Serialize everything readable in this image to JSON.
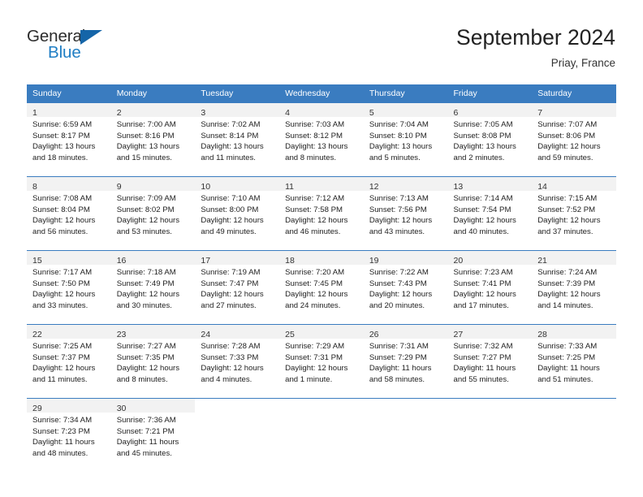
{
  "brand": {
    "word_one": "General",
    "word_two": "Blue",
    "triangle_color": "#1565a8",
    "blue_color": "#1f7ec4"
  },
  "header": {
    "title": "September 2024",
    "subtitle": "Priay, France"
  },
  "theme": {
    "header_blue": "#3a7cc0",
    "day_strip_gray": "#f2f2f2"
  },
  "weekdays": [
    "Sunday",
    "Monday",
    "Tuesday",
    "Wednesday",
    "Thursday",
    "Friday",
    "Saturday"
  ],
  "weeks": [
    [
      {
        "day": "1",
        "sunrise": "Sunrise: 6:59 AM",
        "sunset": "Sunset: 8:17 PM",
        "daylight_1": "Daylight: 13 hours",
        "daylight_2": "and 18 minutes."
      },
      {
        "day": "2",
        "sunrise": "Sunrise: 7:00 AM",
        "sunset": "Sunset: 8:16 PM",
        "daylight_1": "Daylight: 13 hours",
        "daylight_2": "and 15 minutes."
      },
      {
        "day": "3",
        "sunrise": "Sunrise: 7:02 AM",
        "sunset": "Sunset: 8:14 PM",
        "daylight_1": "Daylight: 13 hours",
        "daylight_2": "and 11 minutes."
      },
      {
        "day": "4",
        "sunrise": "Sunrise: 7:03 AM",
        "sunset": "Sunset: 8:12 PM",
        "daylight_1": "Daylight: 13 hours",
        "daylight_2": "and 8 minutes."
      },
      {
        "day": "5",
        "sunrise": "Sunrise: 7:04 AM",
        "sunset": "Sunset: 8:10 PM",
        "daylight_1": "Daylight: 13 hours",
        "daylight_2": "and 5 minutes."
      },
      {
        "day": "6",
        "sunrise": "Sunrise: 7:05 AM",
        "sunset": "Sunset: 8:08 PM",
        "daylight_1": "Daylight: 13 hours",
        "daylight_2": "and 2 minutes."
      },
      {
        "day": "7",
        "sunrise": "Sunrise: 7:07 AM",
        "sunset": "Sunset: 8:06 PM",
        "daylight_1": "Daylight: 12 hours",
        "daylight_2": "and 59 minutes."
      }
    ],
    [
      {
        "day": "8",
        "sunrise": "Sunrise: 7:08 AM",
        "sunset": "Sunset: 8:04 PM",
        "daylight_1": "Daylight: 12 hours",
        "daylight_2": "and 56 minutes."
      },
      {
        "day": "9",
        "sunrise": "Sunrise: 7:09 AM",
        "sunset": "Sunset: 8:02 PM",
        "daylight_1": "Daylight: 12 hours",
        "daylight_2": "and 53 minutes."
      },
      {
        "day": "10",
        "sunrise": "Sunrise: 7:10 AM",
        "sunset": "Sunset: 8:00 PM",
        "daylight_1": "Daylight: 12 hours",
        "daylight_2": "and 49 minutes."
      },
      {
        "day": "11",
        "sunrise": "Sunrise: 7:12 AM",
        "sunset": "Sunset: 7:58 PM",
        "daylight_1": "Daylight: 12 hours",
        "daylight_2": "and 46 minutes."
      },
      {
        "day": "12",
        "sunrise": "Sunrise: 7:13 AM",
        "sunset": "Sunset: 7:56 PM",
        "daylight_1": "Daylight: 12 hours",
        "daylight_2": "and 43 minutes."
      },
      {
        "day": "13",
        "sunrise": "Sunrise: 7:14 AM",
        "sunset": "Sunset: 7:54 PM",
        "daylight_1": "Daylight: 12 hours",
        "daylight_2": "and 40 minutes."
      },
      {
        "day": "14",
        "sunrise": "Sunrise: 7:15 AM",
        "sunset": "Sunset: 7:52 PM",
        "daylight_1": "Daylight: 12 hours",
        "daylight_2": "and 37 minutes."
      }
    ],
    [
      {
        "day": "15",
        "sunrise": "Sunrise: 7:17 AM",
        "sunset": "Sunset: 7:50 PM",
        "daylight_1": "Daylight: 12 hours",
        "daylight_2": "and 33 minutes."
      },
      {
        "day": "16",
        "sunrise": "Sunrise: 7:18 AM",
        "sunset": "Sunset: 7:49 PM",
        "daylight_1": "Daylight: 12 hours",
        "daylight_2": "and 30 minutes."
      },
      {
        "day": "17",
        "sunrise": "Sunrise: 7:19 AM",
        "sunset": "Sunset: 7:47 PM",
        "daylight_1": "Daylight: 12 hours",
        "daylight_2": "and 27 minutes."
      },
      {
        "day": "18",
        "sunrise": "Sunrise: 7:20 AM",
        "sunset": "Sunset: 7:45 PM",
        "daylight_1": "Daylight: 12 hours",
        "daylight_2": "and 24 minutes."
      },
      {
        "day": "19",
        "sunrise": "Sunrise: 7:22 AM",
        "sunset": "Sunset: 7:43 PM",
        "daylight_1": "Daylight: 12 hours",
        "daylight_2": "and 20 minutes."
      },
      {
        "day": "20",
        "sunrise": "Sunrise: 7:23 AM",
        "sunset": "Sunset: 7:41 PM",
        "daylight_1": "Daylight: 12 hours",
        "daylight_2": "and 17 minutes."
      },
      {
        "day": "21",
        "sunrise": "Sunrise: 7:24 AM",
        "sunset": "Sunset: 7:39 PM",
        "daylight_1": "Daylight: 12 hours",
        "daylight_2": "and 14 minutes."
      }
    ],
    [
      {
        "day": "22",
        "sunrise": "Sunrise: 7:25 AM",
        "sunset": "Sunset: 7:37 PM",
        "daylight_1": "Daylight: 12 hours",
        "daylight_2": "and 11 minutes."
      },
      {
        "day": "23",
        "sunrise": "Sunrise: 7:27 AM",
        "sunset": "Sunset: 7:35 PM",
        "daylight_1": "Daylight: 12 hours",
        "daylight_2": "and 8 minutes."
      },
      {
        "day": "24",
        "sunrise": "Sunrise: 7:28 AM",
        "sunset": "Sunset: 7:33 PM",
        "daylight_1": "Daylight: 12 hours",
        "daylight_2": "and 4 minutes."
      },
      {
        "day": "25",
        "sunrise": "Sunrise: 7:29 AM",
        "sunset": "Sunset: 7:31 PM",
        "daylight_1": "Daylight: 12 hours",
        "daylight_2": "and 1 minute."
      },
      {
        "day": "26",
        "sunrise": "Sunrise: 7:31 AM",
        "sunset": "Sunset: 7:29 PM",
        "daylight_1": "Daylight: 11 hours",
        "daylight_2": "and 58 minutes."
      },
      {
        "day": "27",
        "sunrise": "Sunrise: 7:32 AM",
        "sunset": "Sunset: 7:27 PM",
        "daylight_1": "Daylight: 11 hours",
        "daylight_2": "and 55 minutes."
      },
      {
        "day": "28",
        "sunrise": "Sunrise: 7:33 AM",
        "sunset": "Sunset: 7:25 PM",
        "daylight_1": "Daylight: 11 hours",
        "daylight_2": "and 51 minutes."
      }
    ],
    [
      {
        "day": "29",
        "sunrise": "Sunrise: 7:34 AM",
        "sunset": "Sunset: 7:23 PM",
        "daylight_1": "Daylight: 11 hours",
        "daylight_2": "and 48 minutes."
      },
      {
        "day": "30",
        "sunrise": "Sunrise: 7:36 AM",
        "sunset": "Sunset: 7:21 PM",
        "daylight_1": "Daylight: 11 hours",
        "daylight_2": "and 45 minutes."
      },
      {
        "day": "",
        "sunrise": "",
        "sunset": "",
        "daylight_1": "",
        "daylight_2": ""
      },
      {
        "day": "",
        "sunrise": "",
        "sunset": "",
        "daylight_1": "",
        "daylight_2": ""
      },
      {
        "day": "",
        "sunrise": "",
        "sunset": "",
        "daylight_1": "",
        "daylight_2": ""
      },
      {
        "day": "",
        "sunrise": "",
        "sunset": "",
        "daylight_1": "",
        "daylight_2": ""
      },
      {
        "day": "",
        "sunrise": "",
        "sunset": "",
        "daylight_1": "",
        "daylight_2": ""
      }
    ]
  ]
}
